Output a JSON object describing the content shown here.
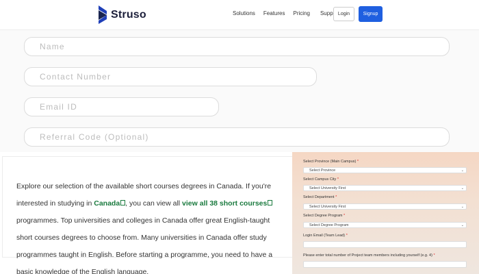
{
  "header": {
    "brand": "Struso",
    "nav": [
      "Solutions",
      "Features",
      "Pricing",
      "Support"
    ],
    "login_label": "Login",
    "signup_label": "Signup",
    "accent": "#1f5fe0"
  },
  "form": {
    "name_placeholder": "Name",
    "contact_placeholder": "Contact Number",
    "email_placeholder": "Email ID",
    "referral_placeholder": "Referral Code (Optional)"
  },
  "article": {
    "p1": "Explore our selection of the available short courses degrees in Canada. If you're interested in studying in ",
    "link1": "Canada",
    "p2": ", you can view all ",
    "link2": "view all 38 short courses",
    "p3": " programmes. Top universities and colleges in Canada offer great English-taught short courses degrees to choose from. Many universities in Canada offer study programmes taught in English. Before starting a programme, you need to have a basic knowledge of the English language.",
    "link_color": "#1a7a3e"
  },
  "registration": {
    "province_label": "Select Province (Main Campus)",
    "province_value": "Select Province",
    "city_label": "Select Campus City",
    "city_value": "Select University First",
    "department_label": "Select Department",
    "department_value": "Select University First",
    "degree_label": "Select Degree Program",
    "degree_value": "Select Degree Program",
    "login_email_label": "Login Email (Team Lead)",
    "team_count_label": "Please enter total number of Project team members including yourself (e.g. 4)",
    "required_mark": "*"
  }
}
